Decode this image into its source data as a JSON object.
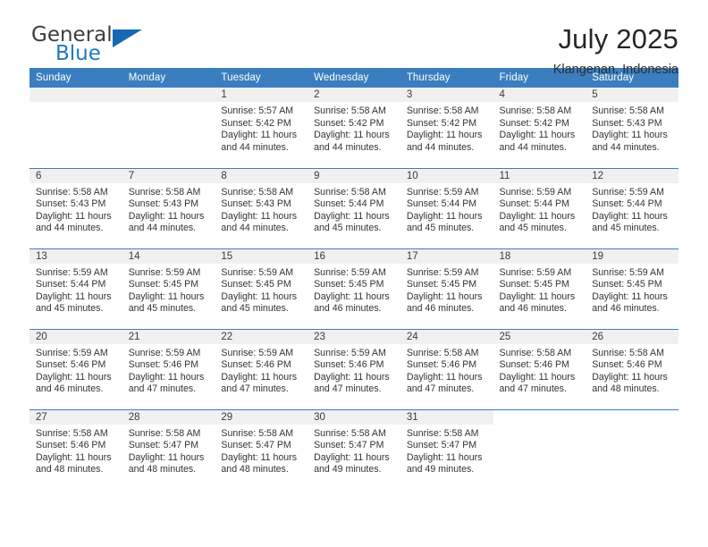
{
  "brand": {
    "name_top": "General",
    "name_bottom": "Blue",
    "triangle_color": "#1668b3",
    "text_color": "#3d3d3d",
    "blue_color": "#1e7ac4"
  },
  "header": {
    "title": "July 2025",
    "subtitle": "Klangenan, Indonesia",
    "accent_color": "#3a7ebf",
    "daynum_band_color": "#f0f0f0"
  },
  "weekday_headers": [
    "Sunday",
    "Monday",
    "Tuesday",
    "Wednesday",
    "Thursday",
    "Friday",
    "Saturday"
  ],
  "calendar": {
    "month": "July",
    "year": "2025",
    "location": "Klangenan, Indonesia",
    "weeks": [
      [
        {
          "day": "",
          "blank": true
        },
        {
          "day": "",
          "blank": true
        },
        {
          "day": "1",
          "sunrise": "Sunrise: 5:57 AM",
          "sunset": "Sunset: 5:42 PM",
          "daylight1": "Daylight: 11 hours",
          "daylight2": "and 44 minutes."
        },
        {
          "day": "2",
          "sunrise": "Sunrise: 5:58 AM",
          "sunset": "Sunset: 5:42 PM",
          "daylight1": "Daylight: 11 hours",
          "daylight2": "and 44 minutes."
        },
        {
          "day": "3",
          "sunrise": "Sunrise: 5:58 AM",
          "sunset": "Sunset: 5:42 PM",
          "daylight1": "Daylight: 11 hours",
          "daylight2": "and 44 minutes."
        },
        {
          "day": "4",
          "sunrise": "Sunrise: 5:58 AM",
          "sunset": "Sunset: 5:42 PM",
          "daylight1": "Daylight: 11 hours",
          "daylight2": "and 44 minutes."
        },
        {
          "day": "5",
          "sunrise": "Sunrise: 5:58 AM",
          "sunset": "Sunset: 5:43 PM",
          "daylight1": "Daylight: 11 hours",
          "daylight2": "and 44 minutes."
        }
      ],
      [
        {
          "day": "6",
          "sunrise": "Sunrise: 5:58 AM",
          "sunset": "Sunset: 5:43 PM",
          "daylight1": "Daylight: 11 hours",
          "daylight2": "and 44 minutes."
        },
        {
          "day": "7",
          "sunrise": "Sunrise: 5:58 AM",
          "sunset": "Sunset: 5:43 PM",
          "daylight1": "Daylight: 11 hours",
          "daylight2": "and 44 minutes."
        },
        {
          "day": "8",
          "sunrise": "Sunrise: 5:58 AM",
          "sunset": "Sunset: 5:43 PM",
          "daylight1": "Daylight: 11 hours",
          "daylight2": "and 44 minutes."
        },
        {
          "day": "9",
          "sunrise": "Sunrise: 5:58 AM",
          "sunset": "Sunset: 5:44 PM",
          "daylight1": "Daylight: 11 hours",
          "daylight2": "and 45 minutes."
        },
        {
          "day": "10",
          "sunrise": "Sunrise: 5:59 AM",
          "sunset": "Sunset: 5:44 PM",
          "daylight1": "Daylight: 11 hours",
          "daylight2": "and 45 minutes."
        },
        {
          "day": "11",
          "sunrise": "Sunrise: 5:59 AM",
          "sunset": "Sunset: 5:44 PM",
          "daylight1": "Daylight: 11 hours",
          "daylight2": "and 45 minutes."
        },
        {
          "day": "12",
          "sunrise": "Sunrise: 5:59 AM",
          "sunset": "Sunset: 5:44 PM",
          "daylight1": "Daylight: 11 hours",
          "daylight2": "and 45 minutes."
        }
      ],
      [
        {
          "day": "13",
          "sunrise": "Sunrise: 5:59 AM",
          "sunset": "Sunset: 5:44 PM",
          "daylight1": "Daylight: 11 hours",
          "daylight2": "and 45 minutes."
        },
        {
          "day": "14",
          "sunrise": "Sunrise: 5:59 AM",
          "sunset": "Sunset: 5:45 PM",
          "daylight1": "Daylight: 11 hours",
          "daylight2": "and 45 minutes."
        },
        {
          "day": "15",
          "sunrise": "Sunrise: 5:59 AM",
          "sunset": "Sunset: 5:45 PM",
          "daylight1": "Daylight: 11 hours",
          "daylight2": "and 45 minutes."
        },
        {
          "day": "16",
          "sunrise": "Sunrise: 5:59 AM",
          "sunset": "Sunset: 5:45 PM",
          "daylight1": "Daylight: 11 hours",
          "daylight2": "and 46 minutes."
        },
        {
          "day": "17",
          "sunrise": "Sunrise: 5:59 AM",
          "sunset": "Sunset: 5:45 PM",
          "daylight1": "Daylight: 11 hours",
          "daylight2": "and 46 minutes."
        },
        {
          "day": "18",
          "sunrise": "Sunrise: 5:59 AM",
          "sunset": "Sunset: 5:45 PM",
          "daylight1": "Daylight: 11 hours",
          "daylight2": "and 46 minutes."
        },
        {
          "day": "19",
          "sunrise": "Sunrise: 5:59 AM",
          "sunset": "Sunset: 5:45 PM",
          "daylight1": "Daylight: 11 hours",
          "daylight2": "and 46 minutes."
        }
      ],
      [
        {
          "day": "20",
          "sunrise": "Sunrise: 5:59 AM",
          "sunset": "Sunset: 5:46 PM",
          "daylight1": "Daylight: 11 hours",
          "daylight2": "and 46 minutes."
        },
        {
          "day": "21",
          "sunrise": "Sunrise: 5:59 AM",
          "sunset": "Sunset: 5:46 PM",
          "daylight1": "Daylight: 11 hours",
          "daylight2": "and 47 minutes."
        },
        {
          "day": "22",
          "sunrise": "Sunrise: 5:59 AM",
          "sunset": "Sunset: 5:46 PM",
          "daylight1": "Daylight: 11 hours",
          "daylight2": "and 47 minutes."
        },
        {
          "day": "23",
          "sunrise": "Sunrise: 5:59 AM",
          "sunset": "Sunset: 5:46 PM",
          "daylight1": "Daylight: 11 hours",
          "daylight2": "and 47 minutes."
        },
        {
          "day": "24",
          "sunrise": "Sunrise: 5:58 AM",
          "sunset": "Sunset: 5:46 PM",
          "daylight1": "Daylight: 11 hours",
          "daylight2": "and 47 minutes."
        },
        {
          "day": "25",
          "sunrise": "Sunrise: 5:58 AM",
          "sunset": "Sunset: 5:46 PM",
          "daylight1": "Daylight: 11 hours",
          "daylight2": "and 47 minutes."
        },
        {
          "day": "26",
          "sunrise": "Sunrise: 5:58 AM",
          "sunset": "Sunset: 5:46 PM",
          "daylight1": "Daylight: 11 hours",
          "daylight2": "and 48 minutes."
        }
      ],
      [
        {
          "day": "27",
          "sunrise": "Sunrise: 5:58 AM",
          "sunset": "Sunset: 5:46 PM",
          "daylight1": "Daylight: 11 hours",
          "daylight2": "and 48 minutes."
        },
        {
          "day": "28",
          "sunrise": "Sunrise: 5:58 AM",
          "sunset": "Sunset: 5:47 PM",
          "daylight1": "Daylight: 11 hours",
          "daylight2": "and 48 minutes."
        },
        {
          "day": "29",
          "sunrise": "Sunrise: 5:58 AM",
          "sunset": "Sunset: 5:47 PM",
          "daylight1": "Daylight: 11 hours",
          "daylight2": "and 48 minutes."
        },
        {
          "day": "30",
          "sunrise": "Sunrise: 5:58 AM",
          "sunset": "Sunset: 5:47 PM",
          "daylight1": "Daylight: 11 hours",
          "daylight2": "and 49 minutes."
        },
        {
          "day": "31",
          "sunrise": "Sunrise: 5:58 AM",
          "sunset": "Sunset: 5:47 PM",
          "daylight1": "Daylight: 11 hours",
          "daylight2": "and 49 minutes."
        },
        {
          "day": "",
          "blank": true,
          "no_band": true
        },
        {
          "day": "",
          "blank": true,
          "no_band": true
        }
      ]
    ]
  }
}
